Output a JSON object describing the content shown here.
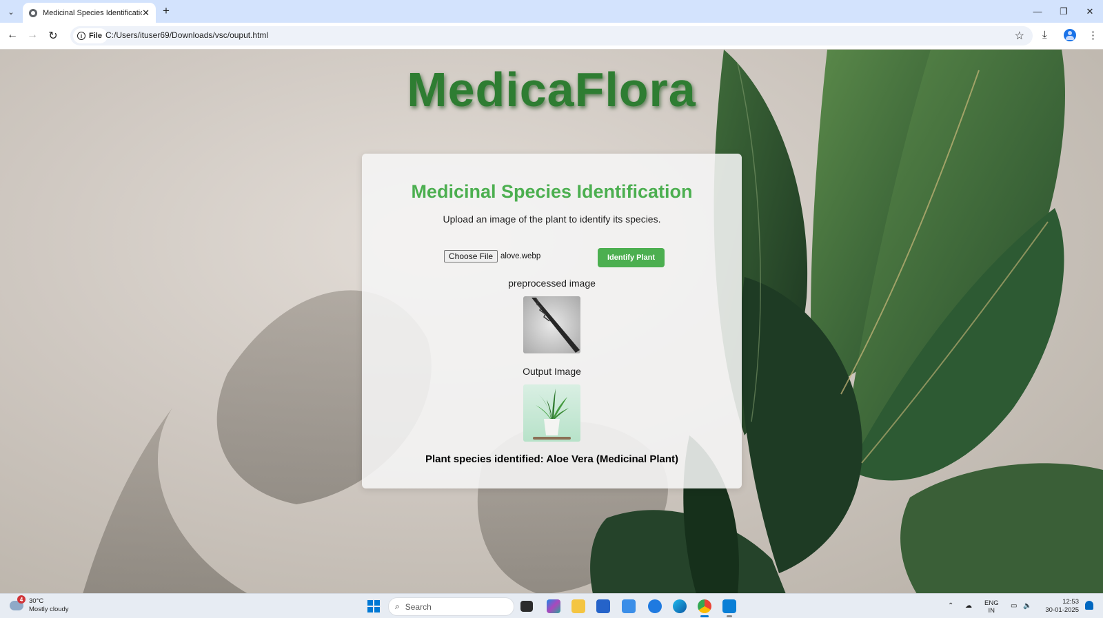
{
  "browser": {
    "tab_title": "Medicinal Species Identification",
    "tab_close": "✕",
    "new_tab": "+",
    "site_label": "File",
    "url": "C:/Users/ituser69/Downloads/vsc/ouput.html",
    "window_controls": {
      "minimize": "—",
      "restore": "❐",
      "close": "✕"
    }
  },
  "page": {
    "logo": "MedicaFlora",
    "title": "Medicinal Species Identification",
    "description": "Upload an image of the plant to identify its species.",
    "file_button": "Choose File",
    "file_name": "alove.webp",
    "identify_button": "Identify Plant",
    "preprocessed_label": "preprocessed image",
    "output_label": "Output Image",
    "result": "Plant species identified: Aloe Vera (Medicinal Plant)",
    "accent_color": "#4caf50"
  },
  "taskbar": {
    "weather_badge": "4",
    "temperature": "30°C",
    "weather": "Mostly cloudy",
    "search_placeholder": "Search",
    "language": "ENG",
    "region": "IN",
    "time": "12:53",
    "date": "30-01-2025"
  }
}
